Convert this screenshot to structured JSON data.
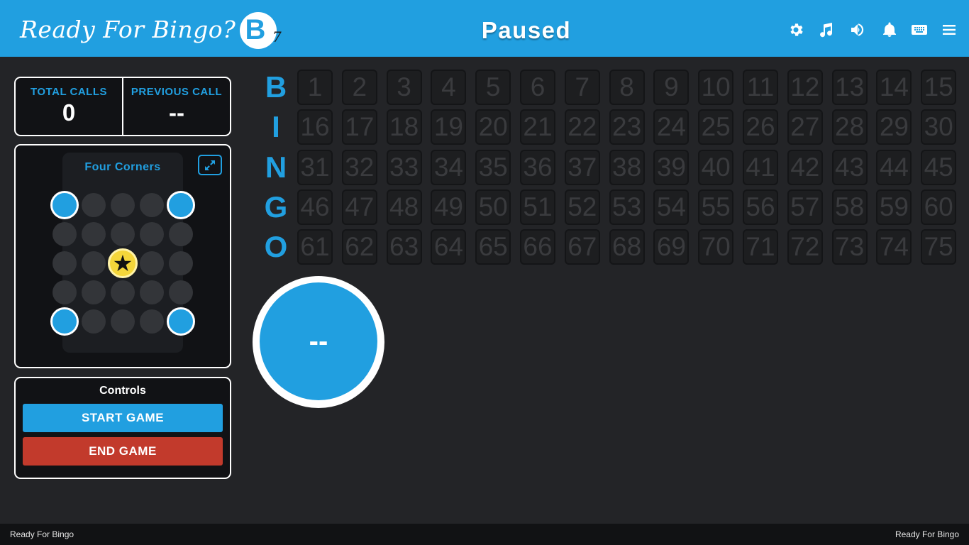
{
  "header": {
    "brand": "Ready For  Bingo?",
    "logo_letter": "B",
    "logo_number": "7",
    "status": "Paused",
    "icons": [
      "gear-icon",
      "music-icon",
      "volume-icon",
      "bell-icon",
      "keyboard-icon",
      "menu-icon"
    ],
    "accent_color": "#219fe0"
  },
  "calls": {
    "total_label": "TOTAL CALLS",
    "total_value": "0",
    "previous_label": "PREVIOUS CALL",
    "previous_value": "--"
  },
  "pattern": {
    "name": "Four Corners",
    "grid": [
      [
        1,
        0,
        0,
        0,
        1
      ],
      [
        0,
        0,
        0,
        0,
        0
      ],
      [
        0,
        0,
        2,
        0,
        0
      ],
      [
        0,
        0,
        0,
        0,
        0
      ],
      [
        1,
        0,
        0,
        0,
        1
      ]
    ],
    "free_symbol": "★"
  },
  "controls": {
    "title": "Controls",
    "start_label": "START GAME",
    "end_label": "END GAME",
    "start_color": "#219fe0",
    "end_color": "#c23a2c"
  },
  "board": {
    "letters": [
      "B",
      "I",
      "N",
      "G",
      "O"
    ],
    "called": []
  },
  "current_ball": "--",
  "footer": {
    "left": "Ready For Bingo",
    "right": "Ready For Bingo"
  }
}
